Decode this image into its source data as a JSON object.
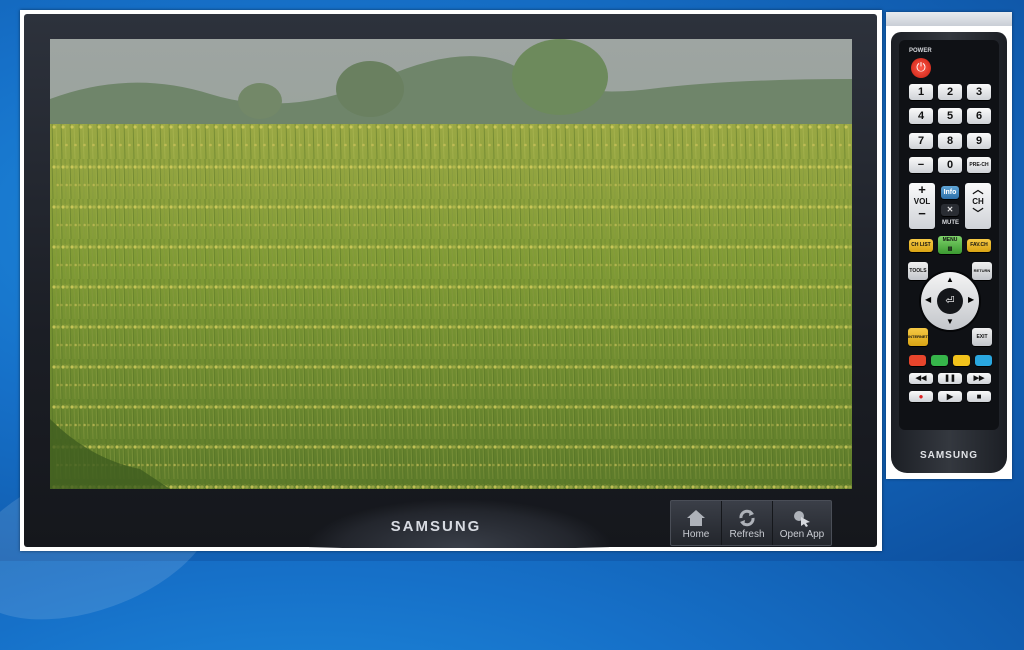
{
  "tv": {
    "brand": "SAMSUNG",
    "screen_image": "field-of-yellow-flowers",
    "toolbar": [
      {
        "label": "Home",
        "icon": "home-icon"
      },
      {
        "label": "Refresh",
        "icon": "refresh-icon"
      },
      {
        "label": "Open App",
        "icon": "open-app-icon"
      }
    ]
  },
  "remote": {
    "brand": "SAMSUNG",
    "power_label": "POWER",
    "digits": [
      "1",
      "2",
      "3",
      "4",
      "5",
      "6",
      "7",
      "8",
      "9",
      "−",
      "0",
      "PRE-CH"
    ],
    "vol_plus": "+",
    "vol_label": "VOL",
    "vol_minus": "−",
    "info_label": "Info",
    "mute_label": "MUTE",
    "ch_label": "CH",
    "chlist_label": "CH LIST",
    "menu_label": "MENU",
    "favch_label": "FAV.CH",
    "tools_label": "TOOLS",
    "return_label": "RETURN",
    "internet_label": "INTERNET",
    "exit_label": "EXIT",
    "color_keys": [
      "#e8452c",
      "#36b54a",
      "#f2c21b",
      "#2aa7e0"
    ]
  },
  "colors": {
    "desktop": "#1670c8",
    "bezel": "#1b1e25"
  }
}
